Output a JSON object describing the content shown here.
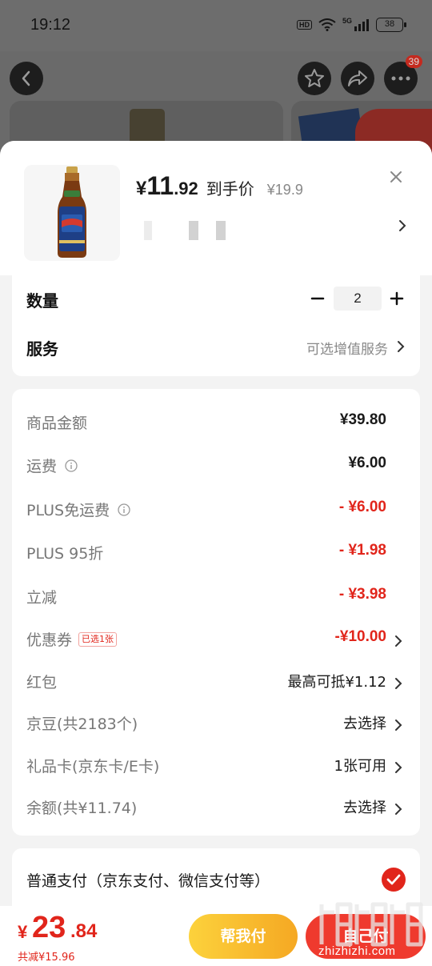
{
  "status_bar": {
    "time": "19:12",
    "hd": "HD",
    "network": "5G",
    "battery": "38"
  },
  "top_bar": {
    "more_badge": "39"
  },
  "product": {
    "price_symbol": "¥",
    "price_integer": "11",
    "price_decimal": ".92",
    "price_label": "到手价",
    "original_price": "¥19.9"
  },
  "quantity": {
    "label": "数量",
    "value": "2"
  },
  "service": {
    "label": "服务",
    "value": "可选增值服务"
  },
  "fees": [
    {
      "label": "商品金额",
      "value": "¥39.80"
    },
    {
      "label": "运费",
      "value": "¥6.00"
    },
    {
      "label": "PLUS免运费",
      "value": "- ¥6.00"
    },
    {
      "label": "PLUS 95折",
      "value": "- ¥1.98"
    },
    {
      "label": "立减",
      "value": "- ¥3.98"
    },
    {
      "label": "优惠券",
      "tag": "已选1张",
      "value": "-¥10.00"
    },
    {
      "label": "红包",
      "value": "最高可抵¥1.12"
    },
    {
      "label": "京豆(共2183个)",
      "value": "去选择"
    },
    {
      "label": "礼品卡(京东卡/E卡)",
      "value": "1张可用"
    },
    {
      "label": "余额(共¥11.74)",
      "value": "去选择"
    }
  ],
  "payment": {
    "label": "普通支付（京东支付、微信支付等）"
  },
  "bottom_bar": {
    "total_symbol": "¥",
    "total_integer": "23",
    "total_decimal": ".84",
    "saved": "共减¥15.96",
    "help_pay": "帮我付",
    "self_pay": "自己付"
  },
  "watermark": {
    "text": "zhizhizhi.com"
  },
  "colors": {
    "accent_red": "#e1251b",
    "button_yellow": "#f5a823",
    "button_red": "#ef3a2e"
  }
}
